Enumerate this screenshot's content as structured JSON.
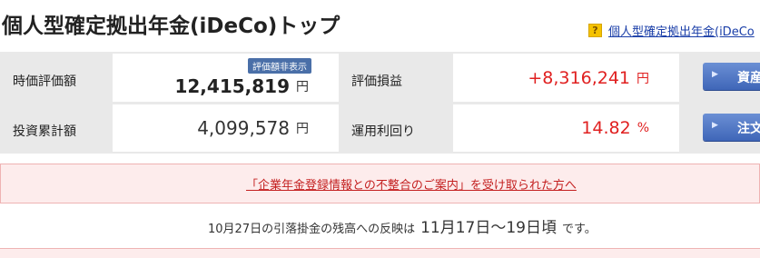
{
  "header": {
    "title": "個人型確定拠出年金(iDeCo)トップ",
    "help_badge": "?",
    "help_link": "個人型確定拠出年金(iDeCo"
  },
  "summary": {
    "market_value_label": "時価評価額",
    "hidden_badge": "評価額非表示",
    "market_value": "12,415,819",
    "market_value_unit": "円",
    "gain_label": "評価損益",
    "gain_value": "+8,316,241",
    "gain_unit": "円",
    "invested_label": "投資累計額",
    "invested_value": "4,099,578",
    "invested_unit": "円",
    "yield_label": "運用利回り",
    "yield_value": "14.82",
    "yield_unit": "%",
    "btn_assets": "資産",
    "btn_order": "注文"
  },
  "notice": {
    "link_text": "「企業年金登録情報との不整合のご案内」を受け取られた方へ"
  },
  "reflect": {
    "prefix": "10月27日の引落掛金の残高への反映は",
    "period": "11月17日〜19日頃",
    "suffix": "です。"
  },
  "colors": {
    "accent_red": "#e02020",
    "button_blue": "#3f66b8",
    "notice_bg": "#fdecec"
  }
}
